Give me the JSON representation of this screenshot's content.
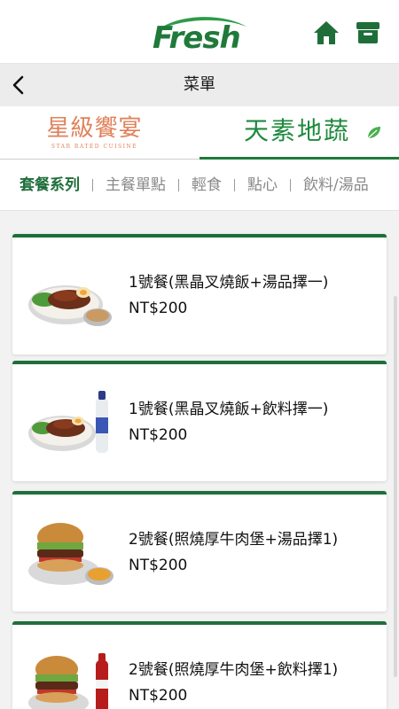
{
  "header": {
    "logo_text": "Fresh",
    "home_icon": "home-icon",
    "box_icon": "archive-box-icon",
    "brand_color": "#1f7a3a"
  },
  "title_bar": {
    "back_icon": "chevron-left-icon",
    "title": "菜單"
  },
  "brand_tabs": [
    {
      "label": "星級饗宴",
      "sublabel": "STAR RATED CUISINE",
      "active": false,
      "color": "#e0815a"
    },
    {
      "label": "天素地蔬",
      "active": true,
      "color": "#1f8a3e"
    }
  ],
  "categories": [
    {
      "label": "套餐系列",
      "active": true
    },
    {
      "label": "主餐單點",
      "active": false
    },
    {
      "label": "輕食",
      "active": false
    },
    {
      "label": "點心",
      "active": false
    },
    {
      "label": "飲料/湯品",
      "active": false
    }
  ],
  "menu_items": [
    {
      "name": "1號餐(黑晶叉燒飯+湯品擇一)",
      "price": "NT$200",
      "image": "bbq-pork-rice-with-soup"
    },
    {
      "name": "1號餐(黑晶叉燒飯+飲料擇一)",
      "price": "NT$200",
      "image": "bbq-pork-rice-with-drink"
    },
    {
      "name": "2號餐(照燒厚牛肉堡+湯品擇1)",
      "price": "NT$200",
      "image": "teriyaki-beef-burger-with-soup"
    },
    {
      "name": "2號餐(照燒厚牛肉堡+飲料擇1)",
      "price": "NT$200",
      "image": "teriyaki-beef-burger-with-cola"
    }
  ],
  "colors": {
    "accent": "#1f6e3a",
    "background": "#f2f2f2"
  }
}
